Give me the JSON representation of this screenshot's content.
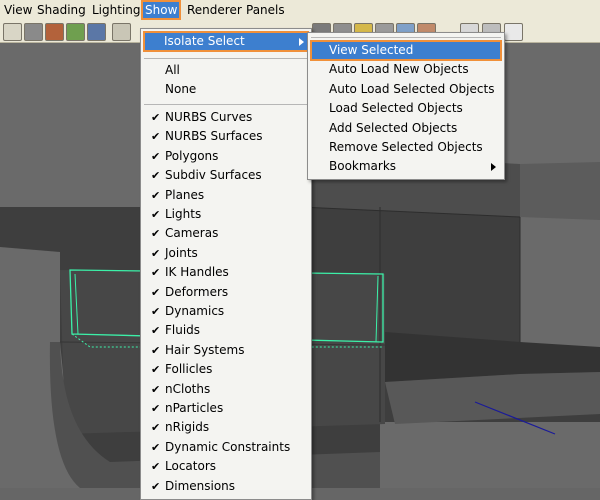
{
  "menubar": {
    "items": [
      {
        "label": "View"
      },
      {
        "label": "Shading"
      },
      {
        "label": "Lighting"
      },
      {
        "label": "Show"
      },
      {
        "label": "Renderer"
      },
      {
        "label": "Panels"
      }
    ],
    "active_index": 3
  },
  "show_menu": {
    "isolate_select_label": "Isolate Select",
    "all_label": "All",
    "none_label": "None",
    "items": [
      {
        "label": "NURBS Curves",
        "checked": true
      },
      {
        "label": "NURBS Surfaces",
        "checked": true
      },
      {
        "label": "Polygons",
        "checked": true
      },
      {
        "label": "Subdiv Surfaces",
        "checked": true
      },
      {
        "label": "Planes",
        "checked": true
      },
      {
        "label": "Lights",
        "checked": true
      },
      {
        "label": "Cameras",
        "checked": true
      },
      {
        "label": "Joints",
        "checked": true
      },
      {
        "label": "IK Handles",
        "checked": true
      },
      {
        "label": "Deformers",
        "checked": true
      },
      {
        "label": "Dynamics",
        "checked": true
      },
      {
        "label": "Fluids",
        "checked": true
      },
      {
        "label": "Hair Systems",
        "checked": true
      },
      {
        "label": "Follicles",
        "checked": true
      },
      {
        "label": "nCloths",
        "checked": true
      },
      {
        "label": "nParticles",
        "checked": true
      },
      {
        "label": "nRigids",
        "checked": true
      },
      {
        "label": "Dynamic Constraints",
        "checked": true
      },
      {
        "label": "Locators",
        "checked": true
      },
      {
        "label": "Dimensions",
        "checked": true
      }
    ]
  },
  "isolate_submenu": {
    "items": [
      {
        "label": "View Selected"
      },
      {
        "label": "Auto Load New Objects"
      },
      {
        "label": "Auto Load Selected Objects"
      },
      {
        "label": "Load Selected Objects"
      },
      {
        "label": "Add Selected Objects"
      },
      {
        "label": "Remove Selected Objects"
      },
      {
        "label": "Bookmarks"
      }
    ],
    "highlighted_index": 0
  },
  "colors": {
    "highlight": "#3d7fcf",
    "highlight_outline": "#f0903a",
    "selection_wire": "#3cf0a8"
  }
}
